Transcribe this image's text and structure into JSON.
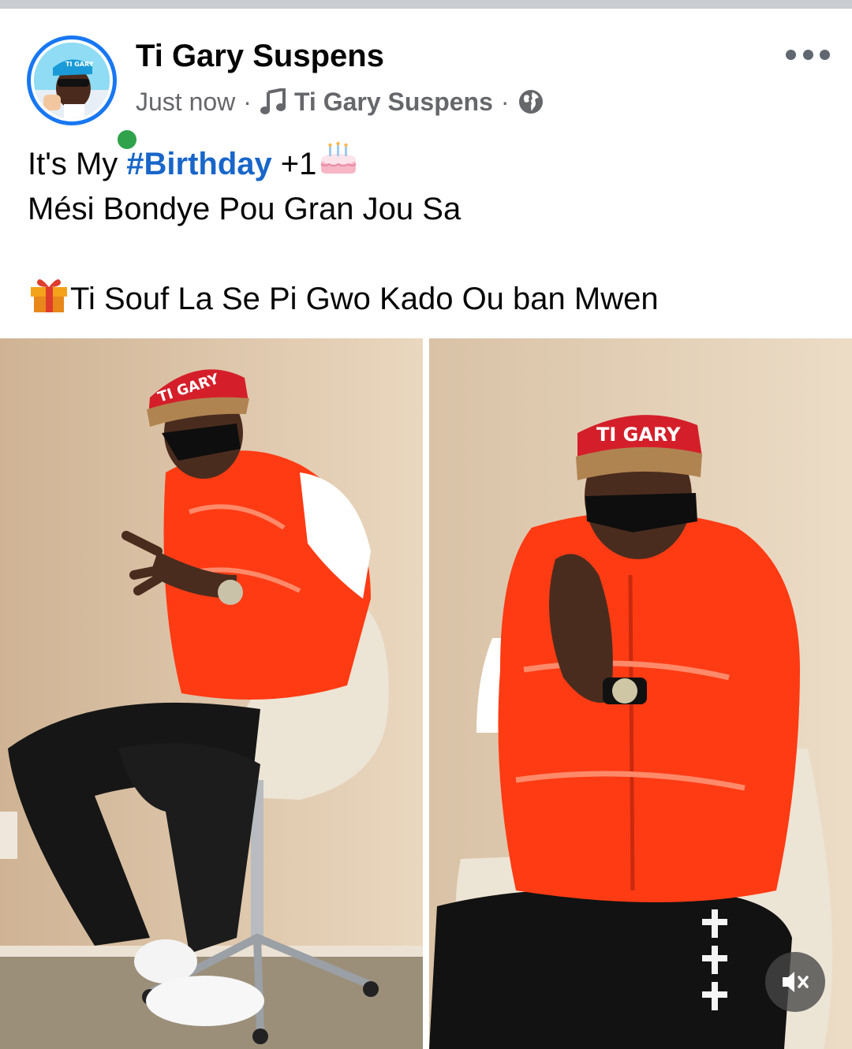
{
  "post": {
    "author": "Ti Gary Suspens",
    "timestamp": "Just now",
    "separator": "·",
    "music_artist": "Ti Gary Suspens",
    "privacy_icon": "globe-icon",
    "more_icon": "more-options-icon",
    "avatar_cap_text": "TI GARY",
    "text": {
      "line1_prefix": "It's My",
      "hashtag": "#Birthday",
      "line1_suffix": "+1",
      "line1_emoji": "birthday-cake-emoji",
      "line2": "Mési Bondye Pou Gran Jou Sa",
      "line4_emoji": "gift-emoji",
      "line4": "Ti Souf La Se Pi Gwo Kado Ou ban Mwen"
    },
    "photos": [
      {
        "name": "photo-left",
        "cap_text": "TI GARY"
      },
      {
        "name": "photo-right",
        "cap_text": "TI GARY"
      }
    ],
    "video_control": "mute-icon"
  },
  "colors": {
    "name_text": "#050505",
    "meta_text": "#65676b",
    "hashtag": "#1866c9",
    "avatar_ring": "#1877f2",
    "online": "#31a24c",
    "vest": "#ff3b14",
    "divider": "#c9ccd1"
  }
}
